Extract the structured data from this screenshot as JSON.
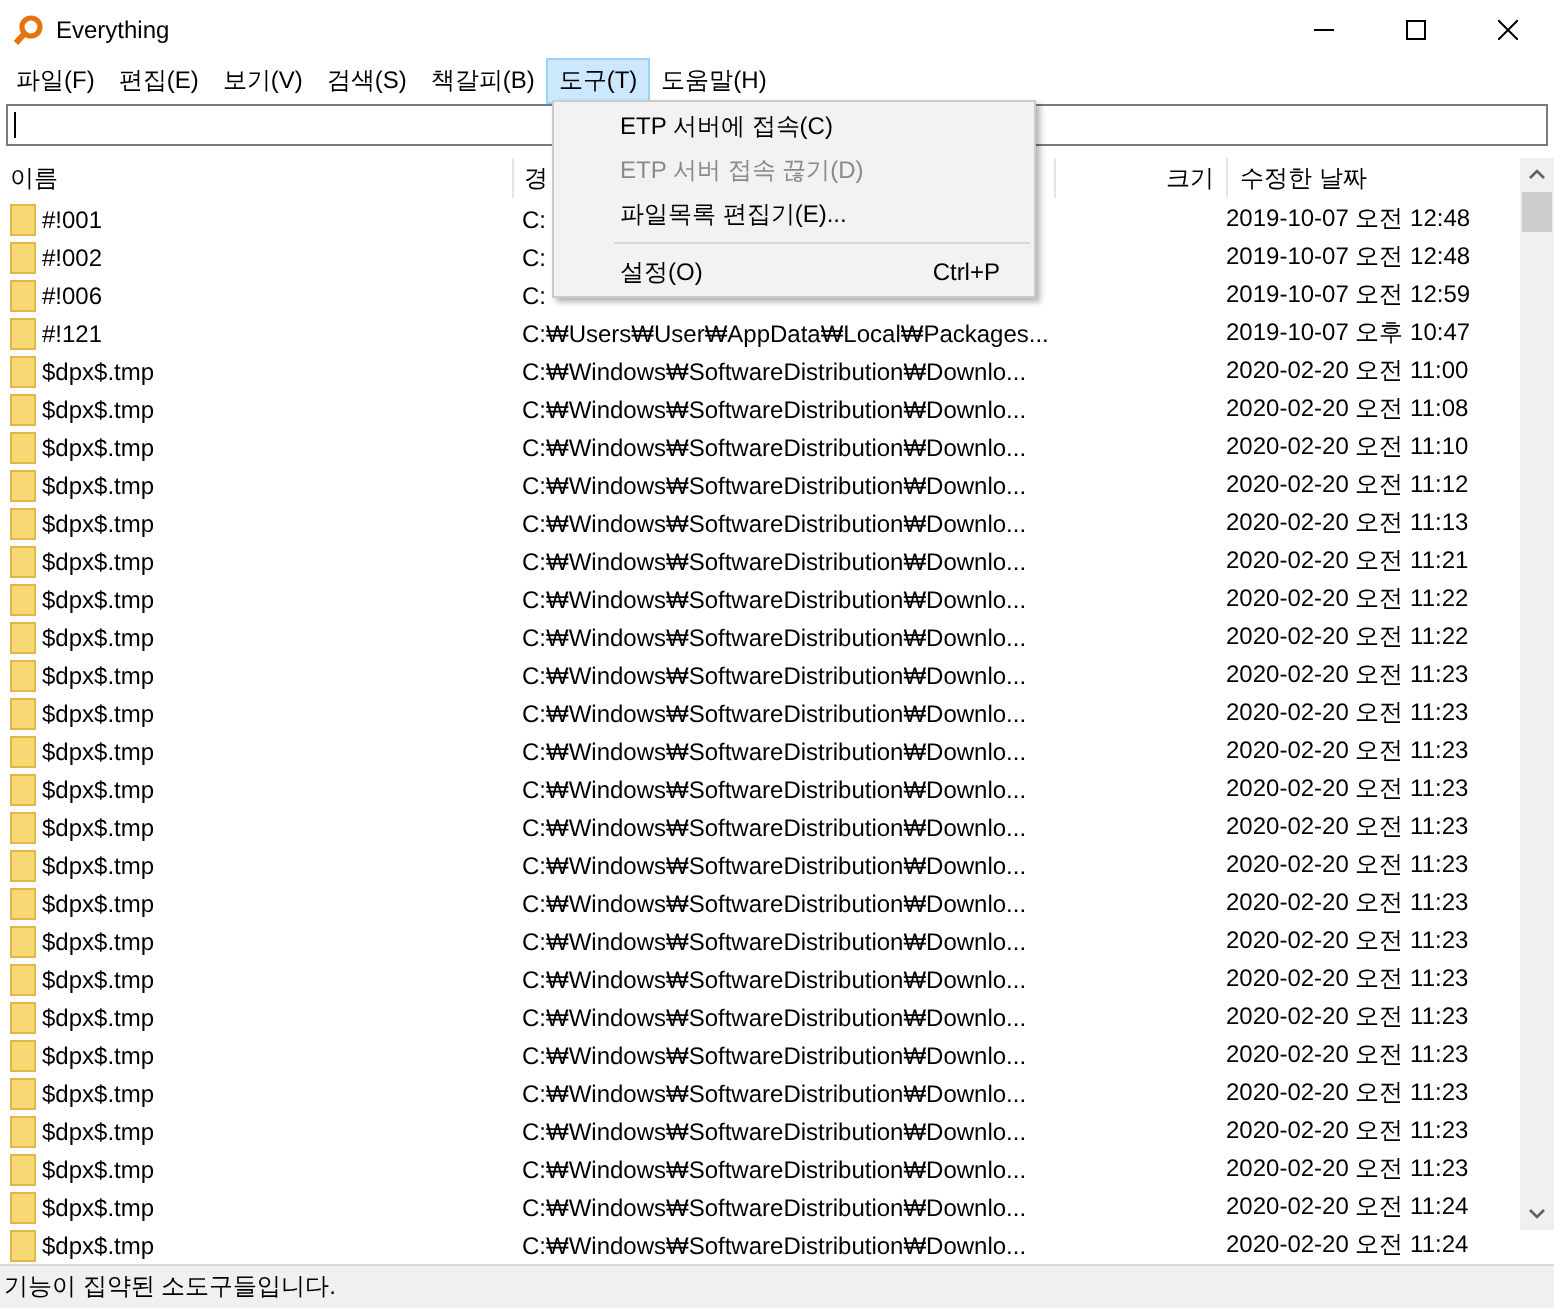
{
  "window": {
    "title": "Everything"
  },
  "menu_bar": [
    {
      "label": "파일(F)",
      "selected": false
    },
    {
      "label": "편집(E)",
      "selected": false
    },
    {
      "label": "보기(V)",
      "selected": false
    },
    {
      "label": "검색(S)",
      "selected": false
    },
    {
      "label": "책갈피(B)",
      "selected": false
    },
    {
      "label": "도구(T)",
      "selected": true
    },
    {
      "label": "도움말(H)",
      "selected": false
    }
  ],
  "dropdown_menu": [
    {
      "kind": "item",
      "label": "ETP 서버에 접속(C)",
      "disabled": false
    },
    {
      "kind": "item",
      "label": "ETP 서버 접속 끊기(D)",
      "disabled": true
    },
    {
      "kind": "item",
      "label": "파일목록 편집기(E)...",
      "disabled": false
    },
    {
      "kind": "separator"
    },
    {
      "kind": "item",
      "label": "설정(O)",
      "shortcut": "Ctrl+P",
      "disabled": false
    }
  ],
  "table": {
    "columns": [
      "이름",
      "경",
      "크기",
      "수정한 날짜"
    ],
    "rows": [
      [
        "#!001",
        "C:",
        "2019-10-07 오전 12:48"
      ],
      [
        "#!002",
        "C:",
        "2019-10-07 오전 12:48"
      ],
      [
        "#!006",
        "C:",
        "2019-10-07 오전 12:59"
      ],
      [
        "#!121",
        "C:₩Users₩User₩AppData₩Local₩Packages...",
        "2019-10-07 오후 10:47"
      ],
      [
        "$dpx$.tmp",
        "C:₩Windows₩SoftwareDistribution₩Downlo...",
        "2020-02-20 오전 11:00"
      ],
      [
        "$dpx$.tmp",
        "C:₩Windows₩SoftwareDistribution₩Downlo...",
        "2020-02-20 오전 11:08"
      ],
      [
        "$dpx$.tmp",
        "C:₩Windows₩SoftwareDistribution₩Downlo...",
        "2020-02-20 오전 11:10"
      ],
      [
        "$dpx$.tmp",
        "C:₩Windows₩SoftwareDistribution₩Downlo...",
        "2020-02-20 오전 11:12"
      ],
      [
        "$dpx$.tmp",
        "C:₩Windows₩SoftwareDistribution₩Downlo...",
        "2020-02-20 오전 11:13"
      ],
      [
        "$dpx$.tmp",
        "C:₩Windows₩SoftwareDistribution₩Downlo...",
        "2020-02-20 오전 11:21"
      ],
      [
        "$dpx$.tmp",
        "C:₩Windows₩SoftwareDistribution₩Downlo...",
        "2020-02-20 오전 11:22"
      ],
      [
        "$dpx$.tmp",
        "C:₩Windows₩SoftwareDistribution₩Downlo...",
        "2020-02-20 오전 11:22"
      ],
      [
        "$dpx$.tmp",
        "C:₩Windows₩SoftwareDistribution₩Downlo...",
        "2020-02-20 오전 11:23"
      ],
      [
        "$dpx$.tmp",
        "C:₩Windows₩SoftwareDistribution₩Downlo...",
        "2020-02-20 오전 11:23"
      ],
      [
        "$dpx$.tmp",
        "C:₩Windows₩SoftwareDistribution₩Downlo...",
        "2020-02-20 오전 11:23"
      ],
      [
        "$dpx$.tmp",
        "C:₩Windows₩SoftwareDistribution₩Downlo...",
        "2020-02-20 오전 11:23"
      ],
      [
        "$dpx$.tmp",
        "C:₩Windows₩SoftwareDistribution₩Downlo...",
        "2020-02-20 오전 11:23"
      ],
      [
        "$dpx$.tmp",
        "C:₩Windows₩SoftwareDistribution₩Downlo...",
        "2020-02-20 오전 11:23"
      ],
      [
        "$dpx$.tmp",
        "C:₩Windows₩SoftwareDistribution₩Downlo...",
        "2020-02-20 오전 11:23"
      ],
      [
        "$dpx$.tmp",
        "C:₩Windows₩SoftwareDistribution₩Downlo...",
        "2020-02-20 오전 11:23"
      ],
      [
        "$dpx$.tmp",
        "C:₩Windows₩SoftwareDistribution₩Downlo...",
        "2020-02-20 오전 11:23"
      ],
      [
        "$dpx$.tmp",
        "C:₩Windows₩SoftwareDistribution₩Downlo...",
        "2020-02-20 오전 11:23"
      ],
      [
        "$dpx$.tmp",
        "C:₩Windows₩SoftwareDistribution₩Downlo...",
        "2020-02-20 오전 11:23"
      ],
      [
        "$dpx$.tmp",
        "C:₩Windows₩SoftwareDistribution₩Downlo...",
        "2020-02-20 오전 11:23"
      ],
      [
        "$dpx$.tmp",
        "C:₩Windows₩SoftwareDistribution₩Downlo...",
        "2020-02-20 오전 11:23"
      ],
      [
        "$dpx$.tmp",
        "C:₩Windows₩SoftwareDistribution₩Downlo...",
        "2020-02-20 오전 11:23"
      ],
      [
        "$dpx$.tmp",
        "C:₩Windows₩SoftwareDistribution₩Downlo...",
        "2020-02-20 오전 11:24"
      ],
      [
        "$dpx$.tmp",
        "C:₩Windows₩SoftwareDistribution₩Downlo...",
        "2020-02-20 오전 11:24"
      ]
    ]
  },
  "status_bar": "기능이 집약된 소도구들입니다."
}
